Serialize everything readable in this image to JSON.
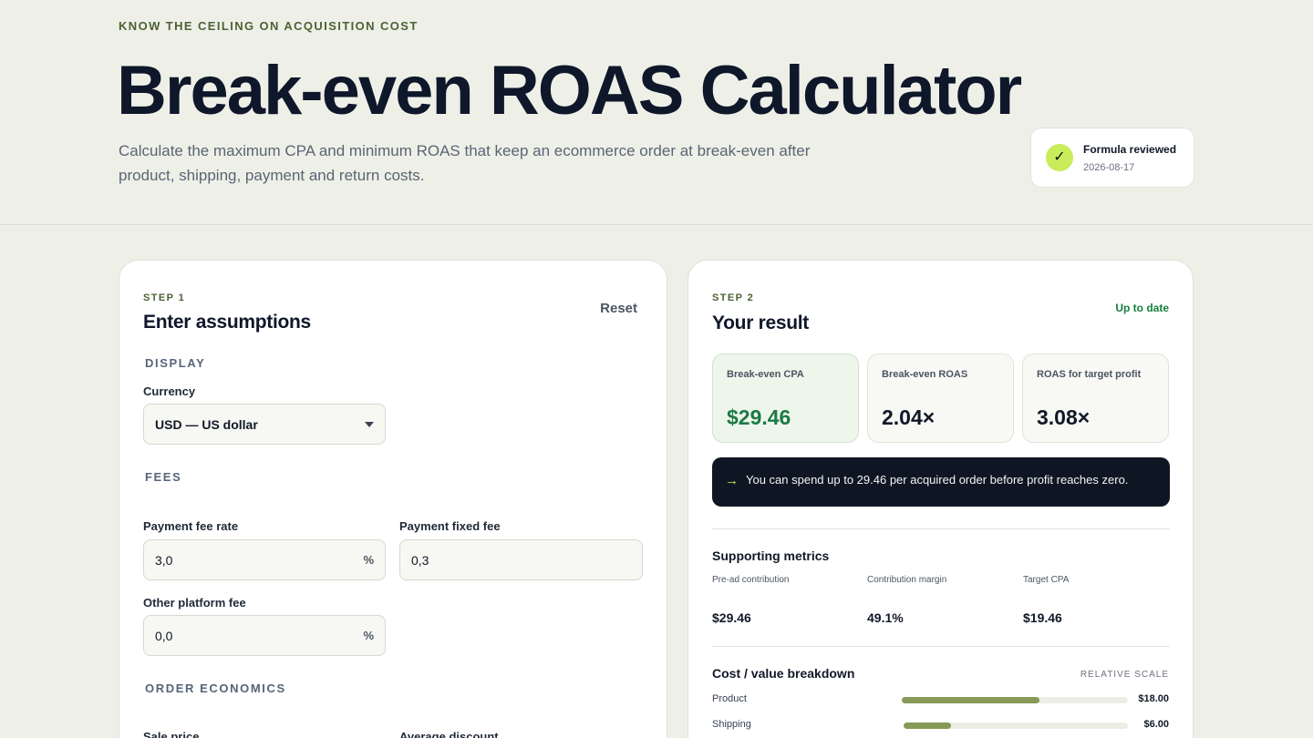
{
  "hero": {
    "eyebrow": "KNOW THE CEILING ON ACQUISITION COST",
    "title": "Break-even ROAS Calculator",
    "subtitle": "Calculate the maximum CPA and minimum ROAS that keep an ecommerce order at break-even after product, shipping, payment and return costs.",
    "review": {
      "icon": "check-icon",
      "title": "Formula reviewed",
      "date": "2026-08-17"
    }
  },
  "inputs": {
    "step": "STEP 1",
    "title": "Enter assumptions",
    "reset_label": "Reset",
    "display_section": "DISPLAY",
    "currency_label": "Currency",
    "currency_value": "USD — US dollar",
    "fees_section": "FEES",
    "payment_fee_rate_label": "Payment fee rate",
    "payment_fee_rate_value": "3,0",
    "payment_fee_rate_unit": "%",
    "payment_fixed_fee_label": "Payment fixed fee",
    "payment_fixed_fee_value": "0,3",
    "other_platform_fee_label": "Other platform fee",
    "other_platform_fee_value": "0,0",
    "other_platform_fee_unit": "%",
    "order_section": "ORDER ECONOMICS",
    "sale_price_label": "Sale price",
    "average_discount_label": "Average discount"
  },
  "result": {
    "step": "STEP 2",
    "title": "Your result",
    "status": "Up to date",
    "kpis": [
      {
        "label": "Break-even CPA",
        "value": "$29.46"
      },
      {
        "label": "Break-even ROAS",
        "value": "2.04×"
      },
      {
        "label": "ROAS for target profit",
        "value": "3.08×"
      }
    ],
    "callout_arrow": "→",
    "callout": "You can spend up to 29.46 per acquired order before profit reaches zero.",
    "supporting_title": "Supporting metrics",
    "metrics": [
      {
        "label": "Pre-ad contribution",
        "value": "$29.46"
      },
      {
        "label": "Contribution margin",
        "value": "49.1%"
      },
      {
        "label": "Target CPA",
        "value": "$19.46"
      }
    ],
    "breakdown_title": "Cost / value breakdown",
    "scale_label": "RELATIVE SCALE",
    "breakdown": [
      {
        "label": "Product",
        "value": "$18.00",
        "share": 0.61
      },
      {
        "label": "Shipping",
        "value": "$6.00",
        "share": 0.21
      }
    ]
  },
  "colors": {
    "accent": "#c8ec5a",
    "positive": "#1b7a44",
    "bar": "#879a58",
    "dark": "#0f1623"
  }
}
